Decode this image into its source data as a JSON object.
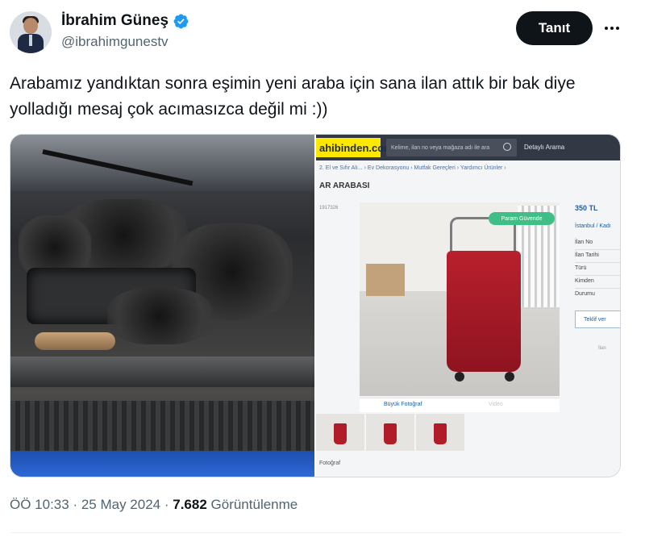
{
  "author": {
    "display_name": "İbrahim Güneş",
    "handle": "@ibrahimgunestv",
    "verified": true
  },
  "actions": {
    "follow_label": "Tanıt"
  },
  "tweet": {
    "text": "Arabamız yandıktan sonra eşimin yeni araba için sana ilan attık bir bak diye yolladığı mesaj çok acımasızca değil mi :))"
  },
  "screenshot": {
    "logo_text": "ahibinden.com",
    "search_placeholder": "Kelime, ilan no veya mağaza adı ile ara",
    "detail_search_label": "Detaylı Arama",
    "breadcrumb": "2. El ve Sıfır Alı... › Ev Dekorasyonu › Mutfak Gereçleri › Yardımcı Ürünler ›",
    "title": "AR ARABASI",
    "listing_id": "1917326",
    "badge": "Param Güvende",
    "price": "350 TL",
    "location": "İstanbul / Kadı",
    "fields": [
      "İlan No",
      "İlan Tarihi",
      "Türü",
      "Kimden",
      "Durumu"
    ],
    "contact_label": "Teklif ver",
    "small_link": "İlan",
    "tab_photo": "Büyük Fotoğraf",
    "tab_video": "Video",
    "thumbs_caption": "Fotoğraf"
  },
  "meta": {
    "time": "ÖÖ 10:33",
    "date": "25 May 2024",
    "views": "7.682",
    "views_label": "Görüntülenme",
    "separator": " · "
  },
  "colors": {
    "verified_blue": "#1d9bf0",
    "text_primary": "#0f1419",
    "text_secondary": "#536471",
    "follow_bg": "#0f1419"
  }
}
